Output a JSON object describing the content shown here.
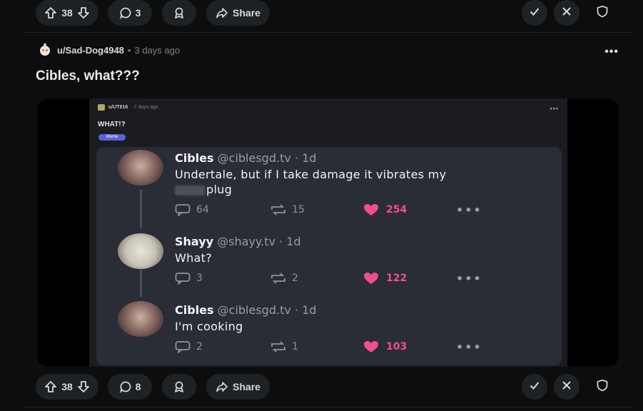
{
  "top_bar": {
    "votes": "38",
    "comments": "3",
    "share_label": "Share"
  },
  "post": {
    "author": "u/Sad-Dog4948",
    "time": "3 days ago",
    "title": "Cibles, what???",
    "more": "•••"
  },
  "embedded": {
    "author": "u/UT816",
    "time": "· 7 days ago",
    "title": "WHAT!?",
    "flair": "Meme",
    "tweets": [
      {
        "name": "Cibles",
        "handle": "@ciblesgd.tv · 1d",
        "line1": "Undertale, but if I take damage it vibrates my",
        "line2": "plug",
        "replies": "64",
        "retweets": "15",
        "likes": "254"
      },
      {
        "name": "Shayy",
        "handle": "@shayy.tv · 1d",
        "line1": "What?",
        "replies": "3",
        "retweets": "2",
        "likes": "122"
      },
      {
        "name": "Cibles",
        "handle": "@ciblesgd.tv · 1d",
        "line1": "I'm cooking",
        "replies": "2",
        "retweets": "1",
        "likes": "103"
      }
    ]
  },
  "bottom_bar": {
    "votes": "38",
    "comments": "8",
    "share_label": "Share"
  },
  "colors": {
    "background": "#0b0d0e",
    "pill": "#1e2224",
    "like": "#f24e8a"
  }
}
